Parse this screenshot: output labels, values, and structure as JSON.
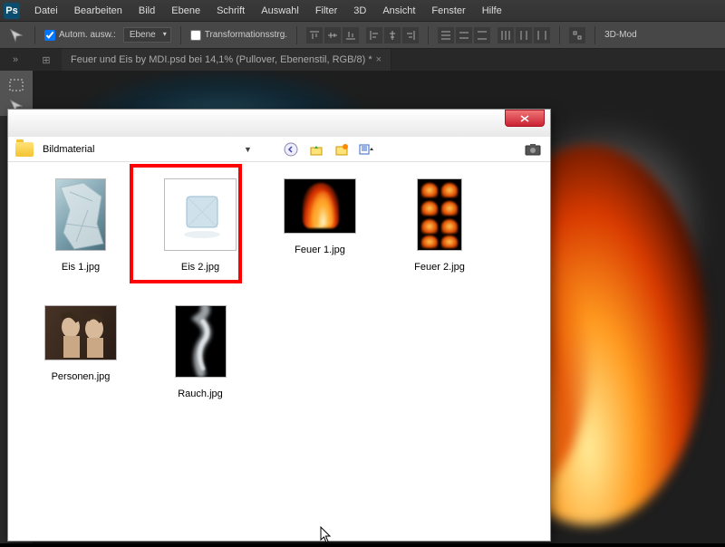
{
  "menubar": {
    "items": [
      "Datei",
      "Bearbeiten",
      "Bild",
      "Ebene",
      "Schrift",
      "Auswahl",
      "Filter",
      "3D",
      "Ansicht",
      "Fenster",
      "Hilfe"
    ]
  },
  "options": {
    "auto_select": "Autom. ausw.:",
    "target": "Ebene",
    "transform": "Transformationsstrg.",
    "mode3d": "3D-Mod"
  },
  "tab": {
    "title": "Feuer und Eis by MDI.psd bei 14,1% (Pullover, Ebenenstil, RGB/8) *"
  },
  "dialog": {
    "folder": "Bildmaterial",
    "files": [
      {
        "name": "Eis 1.jpg"
      },
      {
        "name": "Eis 2.jpg"
      },
      {
        "name": "Feuer 1.jpg"
      },
      {
        "name": "Feuer 2.jpg"
      },
      {
        "name": "Personen.jpg"
      },
      {
        "name": "Rauch.jpg"
      }
    ]
  }
}
